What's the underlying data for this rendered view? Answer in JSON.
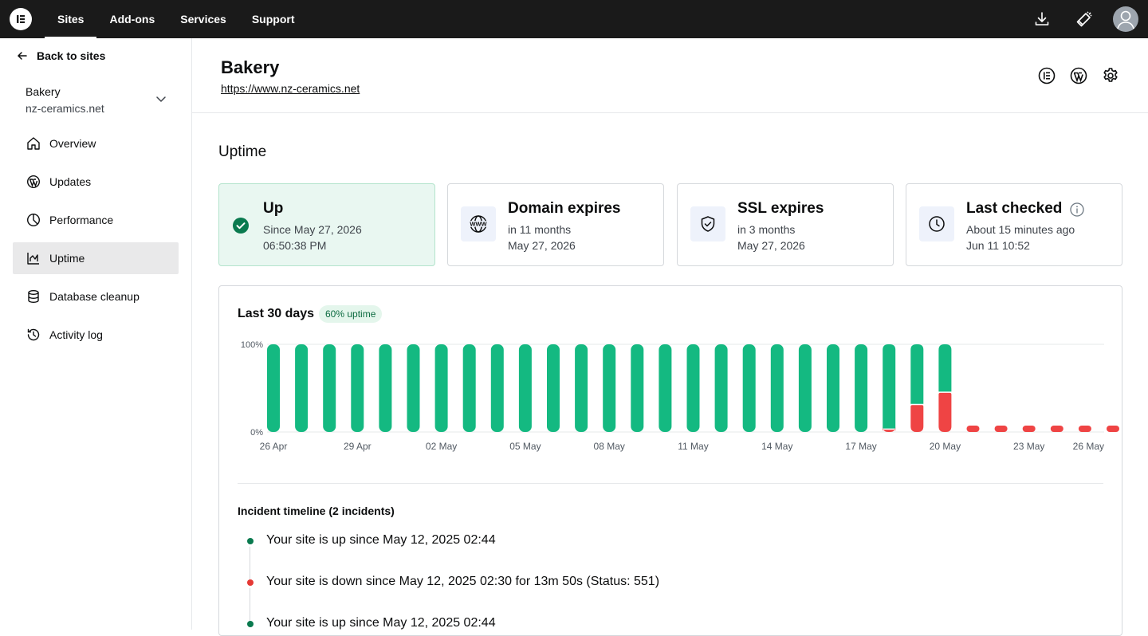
{
  "topnav": {
    "tabs": [
      {
        "label": "Sites",
        "active": true
      },
      {
        "label": "Add-ons",
        "active": false
      },
      {
        "label": "Services",
        "active": false
      },
      {
        "label": "Support",
        "active": false
      }
    ],
    "icons": [
      "download-icon",
      "megaphone-icon",
      "avatar-icon"
    ]
  },
  "sidebar": {
    "back_label": "Back to sites",
    "site_name": "Bakery",
    "site_domain": "nz-ceramics.net",
    "items": [
      {
        "label": "Overview",
        "icon": "home-icon",
        "active": false
      },
      {
        "label": "Updates",
        "icon": "wordpress-icon",
        "active": false
      },
      {
        "label": "Performance",
        "icon": "pie-icon",
        "active": false
      },
      {
        "label": "Uptime",
        "icon": "chart-icon",
        "active": true
      },
      {
        "label": "Database cleanup",
        "icon": "database-icon",
        "active": false
      },
      {
        "label": "Activity log",
        "icon": "history-icon",
        "active": false
      }
    ]
  },
  "header": {
    "title": "Bakery",
    "url": "https://www.nz-ceramics.net"
  },
  "section_title": "Uptime",
  "cards": {
    "up": {
      "title": "Up",
      "line1": "Since May 27, 2026",
      "line2": "06:50:38 PM"
    },
    "domain": {
      "title": "Domain expires",
      "line1": "in 11 months",
      "line2": "May 27, 2026"
    },
    "ssl": {
      "title": "SSL expires",
      "line1": "in 3 months",
      "line2": "May 27, 2026"
    },
    "checked": {
      "title": "Last checked",
      "line1": "About 15 minutes ago",
      "line2": "Jun 11 10:52"
    }
  },
  "panel": {
    "title": "Last 30 days",
    "badge": "60% uptime"
  },
  "chart_data": {
    "type": "bar",
    "title": "Last 30 days",
    "ytick_labels": [
      "100%",
      "0%"
    ],
    "ylim": [
      0,
      100
    ],
    "xtick_labels": [
      "26 Apr",
      "29 Apr",
      "02 May",
      "05 May",
      "08 May",
      "11 May",
      "14 May",
      "17 May",
      "20 May",
      "23 May",
      "26 May"
    ],
    "categories": [
      "26 Apr",
      "27 Apr",
      "28 Apr",
      "29 Apr",
      "30 Apr",
      "01 May",
      "02 May",
      "03 May",
      "04 May",
      "05 May",
      "06 May",
      "07 May",
      "08 May",
      "09 May",
      "10 May",
      "11 May",
      "12 May",
      "13 May",
      "14 May",
      "15 May",
      "16 May",
      "17 May",
      "18 May",
      "19 May",
      "20 May",
      "21 May",
      "22 May",
      "23 May",
      "24 May",
      "25 May",
      "26 May"
    ],
    "series": [
      {
        "name": "Up",
        "color": "#14b981",
        "values": [
          100,
          100,
          100,
          100,
          100,
          100,
          100,
          100,
          100,
          100,
          100,
          100,
          100,
          100,
          100,
          100,
          100,
          100,
          100,
          100,
          100,
          100,
          96,
          68,
          54,
          0,
          0,
          0,
          0,
          0,
          0
        ]
      },
      {
        "name": "Down",
        "color": "#ef4444",
        "values": [
          0,
          0,
          0,
          0,
          0,
          0,
          0,
          0,
          0,
          0,
          0,
          0,
          0,
          0,
          0,
          0,
          0,
          0,
          0,
          0,
          0,
          0,
          4,
          32,
          46,
          100,
          100,
          100,
          100,
          100,
          100
        ]
      }
    ],
    "no_data_days": [
      "21 May",
      "22 May",
      "23 May",
      "24 May",
      "25 May",
      "26 May"
    ],
    "grid": true
  },
  "incidents": {
    "title": "Incident timeline (2 incidents)",
    "items": [
      {
        "text": "Your site is up since May 12, 2025 02:44",
        "status": "up"
      },
      {
        "text": "Your site is down since May 12, 2025 02:30 for 13m 50s (Status: 551)",
        "status": "down"
      },
      {
        "text": "Your site is up since May 12, 2025 02:44",
        "status": "up"
      }
    ]
  },
  "colors": {
    "up": "#14b981",
    "down": "#ef4444",
    "dot_up": "#0a7a4f",
    "dot_down": "#e53935"
  }
}
